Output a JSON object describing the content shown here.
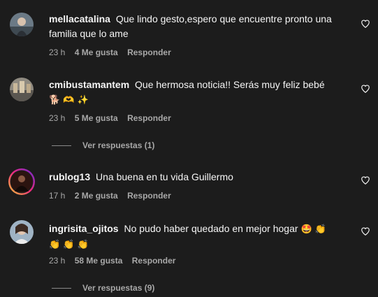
{
  "comments": [
    {
      "username": "mellacatalina",
      "text": "Que lindo gesto,espero que encuentre pronto una familia que lo ame",
      "time": "23 h",
      "likes": "4 Me gusta",
      "reply": "Responder"
    },
    {
      "username": "cmibustamantem",
      "text": "Que hermosa noticia!! Serás muy feliz bebé",
      "emojis": "🐕 🫶 ✨",
      "time": "23 h",
      "likes": "5 Me gusta",
      "reply": "Responder",
      "view_replies": "Ver respuestas (1)"
    },
    {
      "username": "rublog13",
      "text": "Una buena en tu vida Guillermo",
      "time": "17 h",
      "likes": "2 Me gusta",
      "reply": "Responder"
    },
    {
      "username": "ingrisita_ojitos",
      "text": "No pudo haber quedado en mejor hogar",
      "emojis": "🤩 👏",
      "emojis_line2": "👏 👏 👏",
      "time": "23 h",
      "likes": "58 Me gusta",
      "reply": "Responder",
      "view_replies": "Ver respuestas (9)"
    }
  ],
  "icons": {
    "like": "heart-outline-icon"
  },
  "colors": {
    "background": "#1c1c1c",
    "text": "#f5f5f5",
    "secondary": "#a8a8a8",
    "story_ring_start": "#f9ce34",
    "story_ring_mid": "#ee2a7b",
    "story_ring_end": "#6228d7"
  }
}
